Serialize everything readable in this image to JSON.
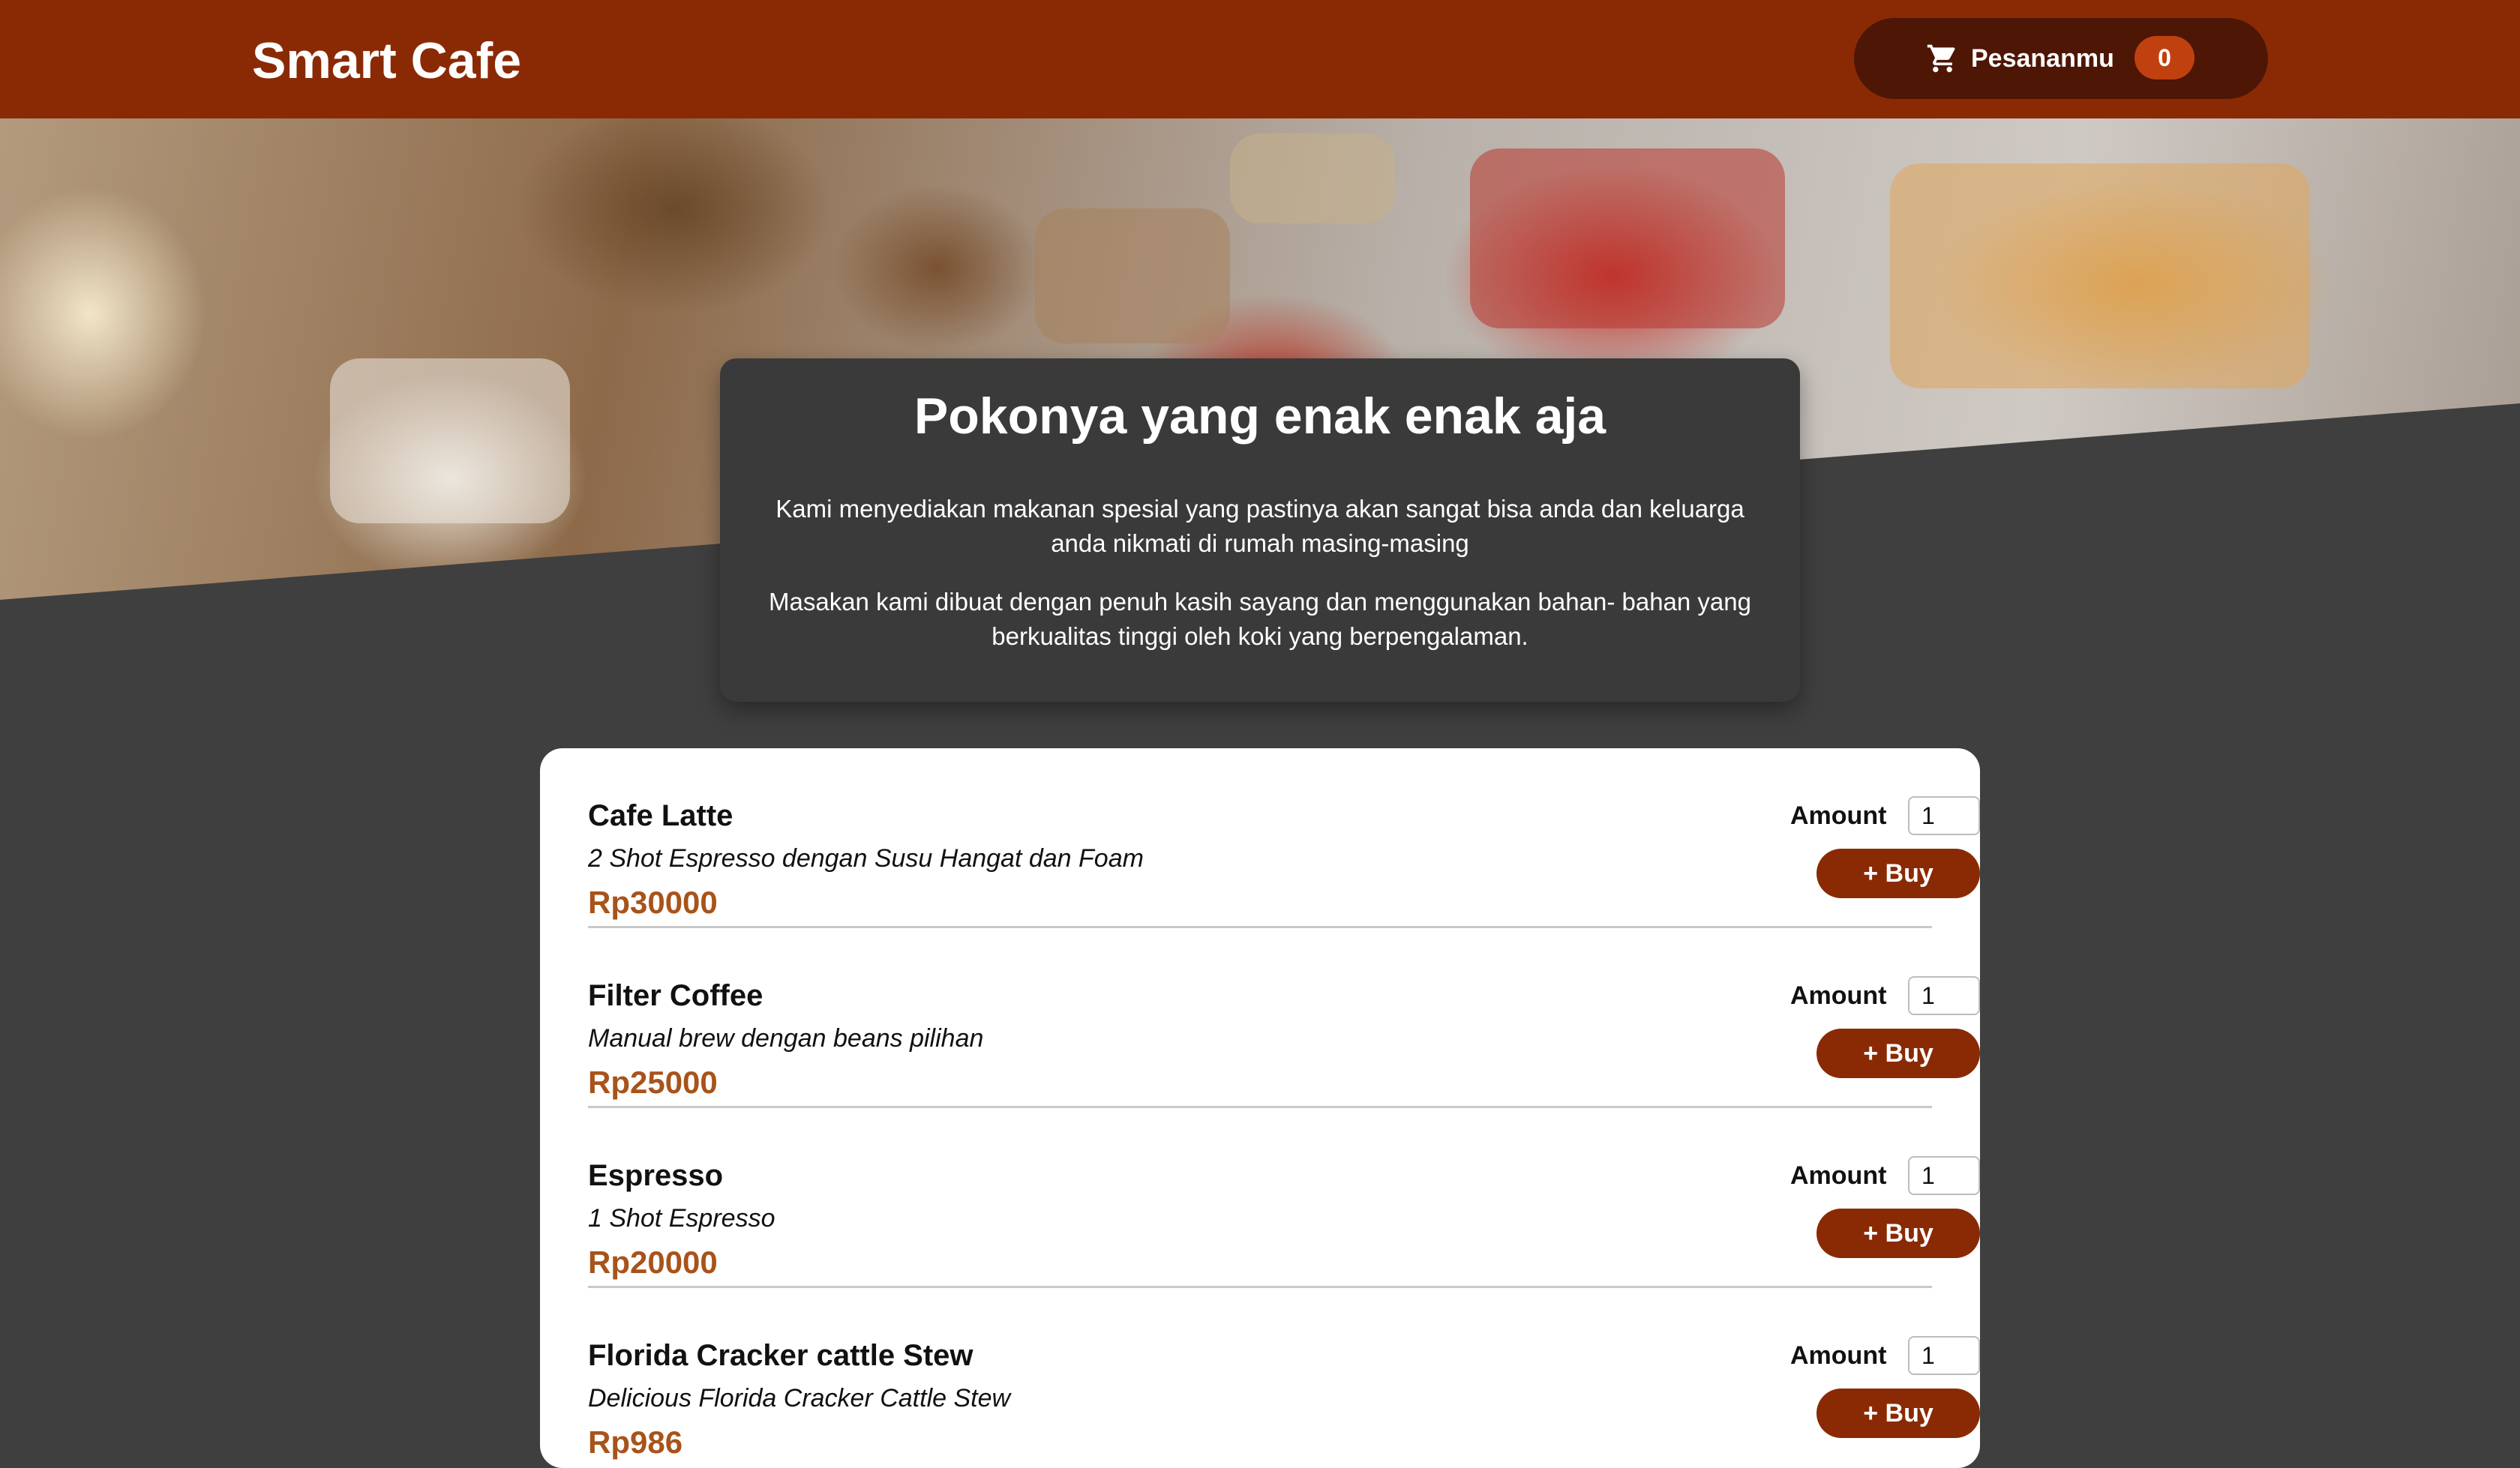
{
  "header": {
    "brand": "Smart Cafe",
    "cart_label": "Pesananmu",
    "cart_count": "0",
    "cart_icon": "cart-icon"
  },
  "intro": {
    "title": "Pokonya yang enak enak aja",
    "paragraph1": "Kami menyediakan makanan spesial yang pastinya akan sangat bisa anda dan keluarga anda nikmati di rumah masing-masing",
    "paragraph2": "Masakan kami dibuat dengan penuh kasih sayang dan menggunakan bahan- bahan yang berkualitas tinggi oleh koki yang berpengalaman."
  },
  "menu": {
    "amount_label": "Amount",
    "buy_label": "+ Buy",
    "items": [
      {
        "name": "Cafe Latte",
        "description": "2 Shot Espresso dengan Susu Hangat dan Foam",
        "price": "Rp30000",
        "amount": "1"
      },
      {
        "name": "Filter Coffee",
        "description": "Manual brew dengan beans pilihan",
        "price": "Rp25000",
        "amount": "1"
      },
      {
        "name": "Espresso",
        "description": "1 Shot Espresso",
        "price": "Rp20000",
        "amount": "1"
      },
      {
        "name": "Florida Cracker cattle Stew",
        "description": "Delicious Florida Cracker Cattle Stew",
        "price": "Rp986",
        "amount": "1"
      }
    ]
  },
  "colors": {
    "header_bg": "#8a2a04",
    "cart_bg": "#4d1605",
    "badge_bg": "#c0410f",
    "price": "#a8531a",
    "page_bg": "#3f3f3f"
  }
}
